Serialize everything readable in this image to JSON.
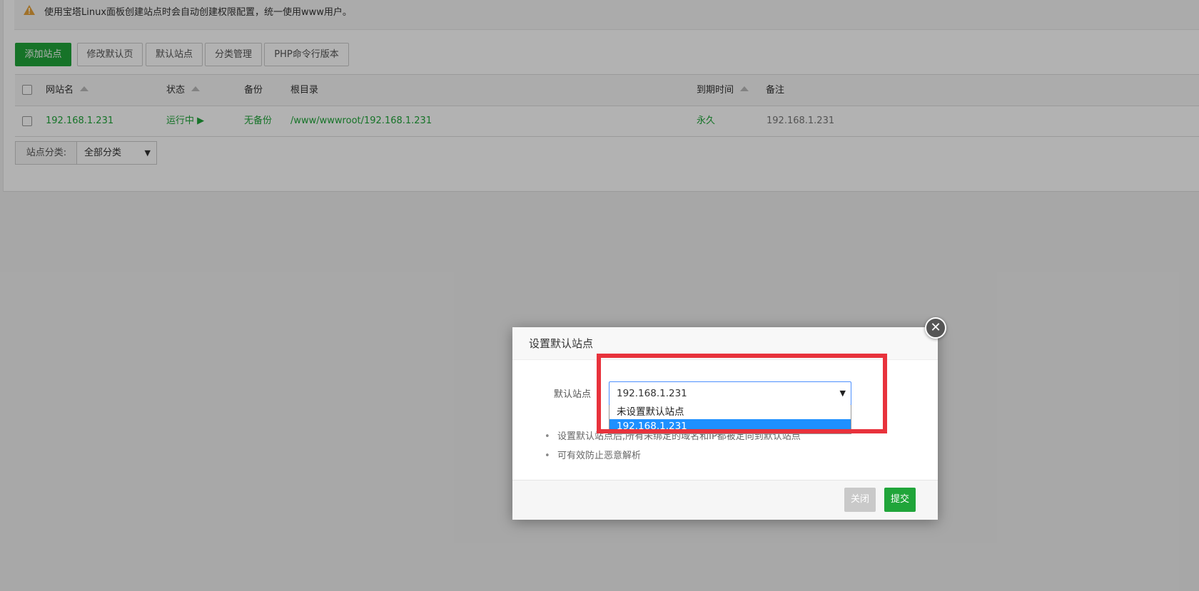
{
  "notice": {
    "text": "使用宝塔Linux面板创建站点时会自动创建权限配置，统一使用www用户。"
  },
  "toolbar": {
    "add_site": "添加站点",
    "edit_default_page": "修改默认页",
    "default_site": "默认站点",
    "category_manage": "分类管理",
    "php_cli_version": "PHP命令行版本"
  },
  "table": {
    "headers": {
      "site_name": "网站名",
      "status": "状态",
      "backup": "备份",
      "root": "根目录",
      "expire": "到期时间",
      "note": "备注"
    },
    "rows": [
      {
        "site_name": "192.168.1.231",
        "status": "运行中 ▶",
        "backup": "无备份",
        "root": "/www/wwwroot/192.168.1.231",
        "expire": "永久",
        "note": "192.168.1.231"
      }
    ]
  },
  "category": {
    "label": "站点分类:",
    "selected": "全部分类"
  },
  "dialog": {
    "title": "设置默认站点",
    "field_label": "默认站点",
    "selected": "192.168.1.231",
    "options": [
      "未设置默认站点",
      "192.168.1.231"
    ],
    "notes": [
      "设置默认站点后,所有未绑定的域名和IP都被定向到默认站点",
      "可有效防止恶意解析"
    ],
    "close_label": "关闭",
    "submit_label": "提交"
  },
  "colors": {
    "brand_green": "#20a53a",
    "highlight_red": "#e8323c",
    "selected_option": "#1e90ff"
  }
}
